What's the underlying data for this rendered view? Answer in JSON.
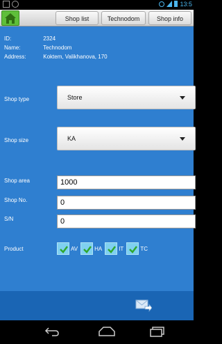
{
  "status_bar": {
    "time": "13:5",
    "icons": [
      "image-icon",
      "whatsapp-icon",
      "alarm-icon",
      "signal-icon",
      "battery-icon"
    ]
  },
  "nav": {
    "home_icon": "home-icon",
    "breadcrumbs": [
      {
        "label": "Shop list"
      },
      {
        "label": "Technodom"
      },
      {
        "label": "Shop info"
      }
    ]
  },
  "info": {
    "id_label": "ID:",
    "id_value": "2324",
    "name_label": "Name:",
    "name_value": "Technodom",
    "address_label": "Address:",
    "address_value": "Koktem, Valikhanova, 170"
  },
  "form": {
    "shop_type_label": "Shop type",
    "shop_type_value": "Store",
    "shop_size_label": "Shop size",
    "shop_size_value": "KA",
    "shop_area_label": "Shop area",
    "shop_area_value": "1000",
    "shop_no_label": "Shop No.",
    "shop_no_value": "0",
    "sn_label": "S/N",
    "sn_value": "0",
    "product_label": "Product",
    "products": [
      {
        "label": "AV",
        "checked": true
      },
      {
        "label": "HA",
        "checked": true
      },
      {
        "label": "IT",
        "checked": true
      },
      {
        "label": "TC",
        "checked": true
      }
    ]
  },
  "actions": {
    "send_icon": "send-mail-icon"
  },
  "system_nav": {
    "back_icon": "back-icon",
    "home_icon": "home-outline-icon",
    "recents_icon": "recents-icon"
  },
  "colors": {
    "form_bg": "#2f7fd0",
    "bottom_bar": "#1a65b4",
    "home_button": "#5fbf3a",
    "checkbox": "#7fd0f0"
  }
}
